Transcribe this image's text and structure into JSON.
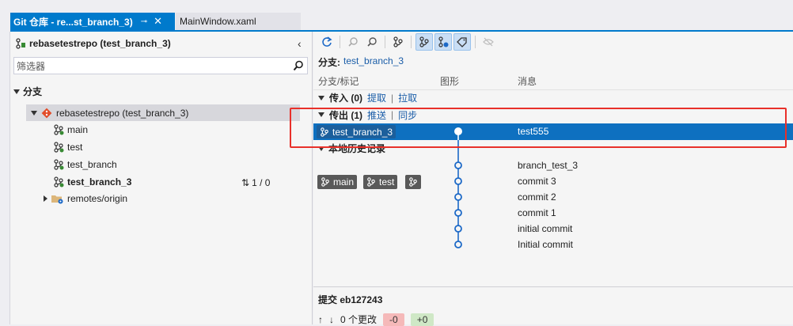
{
  "tabs": [
    {
      "label": "Git 仓库 - re...st_branch_3)",
      "pin": "⊸",
      "close": "✕"
    },
    {
      "label": "MainWindow.xaml"
    }
  ],
  "left": {
    "repo_title": "rebasetestrepo (test_branch_3)",
    "filter_placeholder": "筛选器",
    "section": "分支",
    "repo_node": "rebasetestrepo (test_branch_3)",
    "branches": [
      "main",
      "test",
      "test_branch",
      "test_branch_3"
    ],
    "current_sync": "1 / 0",
    "remotes": "remotes/origin"
  },
  "right": {
    "branch_key": "分支:",
    "branch_value": "test_branch_3",
    "columns": {
      "branch_tag": "分支/标记",
      "graph": "图形",
      "message": "消息"
    },
    "incoming": {
      "label": "传入 (0)",
      "fetch": "提取",
      "pull": "拉取"
    },
    "outgoing": {
      "label": "传出 (1)",
      "push": "推送",
      "sync": "同步"
    },
    "selected_commit": {
      "tag": "test_branch_3",
      "message": "test555"
    },
    "local_history": "本地历史记录",
    "chips": [
      "main",
      "test"
    ],
    "commits": [
      "branch_test_3",
      "commit 3",
      "commit 2",
      "commit 1",
      "initial commit",
      "Initial commit"
    ],
    "detail": {
      "title": "提交 eb127243",
      "changes": "0 个更改",
      "removed": "-0",
      "added": "+0"
    }
  },
  "colors": {
    "accent": "#007acc",
    "selection": "#0e70c0",
    "highlight": "#e8302a"
  }
}
